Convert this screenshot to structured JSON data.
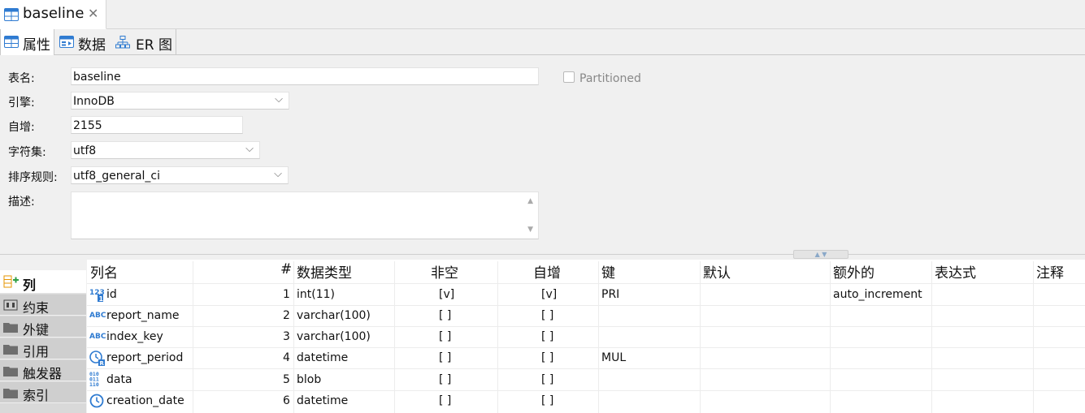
{
  "editor_tab": {
    "title": "baseline",
    "close": "✕"
  },
  "subtabs": [
    {
      "label": "属性"
    },
    {
      "label": "数据"
    },
    {
      "label": "ER 图"
    }
  ],
  "form": {
    "table_name": {
      "label": "表名:",
      "value": "baseline"
    },
    "engine": {
      "label": "引擎:",
      "value": "InnoDB"
    },
    "auto_increment": {
      "label": "自增:",
      "value": "2155"
    },
    "charset": {
      "label": "字符集:",
      "value": "utf8"
    },
    "collation": {
      "label": "排序规则:",
      "value": "utf8_general_ci"
    },
    "description": {
      "label": "描述:",
      "value": ""
    },
    "partitioned": {
      "label": "Partitioned",
      "checked": false
    }
  },
  "side_panel": {
    "items": [
      {
        "label": "列",
        "icon": "add-column-icon",
        "active": true
      },
      {
        "label": "约束",
        "icon": "constraint-icon",
        "active": false
      },
      {
        "label": "外键",
        "icon": "folder-icon",
        "active": false
      },
      {
        "label": "引用",
        "icon": "folder-icon",
        "active": false
      },
      {
        "label": "触发器",
        "icon": "folder-icon",
        "active": false
      },
      {
        "label": "索引",
        "icon": "folder-icon",
        "active": false
      }
    ]
  },
  "columns_table": {
    "headers": {
      "name": "列名",
      "num": "#",
      "type": "数据类型",
      "not_null": "非空",
      "auto_inc": "自增",
      "key": "键",
      "default": "默认",
      "extra": "额外的",
      "expression": "表达式",
      "comment": "注释"
    },
    "rows": [
      {
        "icon": "numeric-key-icon",
        "name": "id",
        "num": "1",
        "type": "int(11)",
        "not_null": "[v]",
        "auto_inc": "[v]",
        "key": "PRI",
        "default": "",
        "extra": "auto_increment",
        "expression": "",
        "comment": ""
      },
      {
        "icon": "text-abc-icon",
        "name": "report_name",
        "num": "2",
        "type": "varchar(100)",
        "not_null": "[ ]",
        "auto_inc": "[ ]",
        "key": "",
        "default": "",
        "extra": "",
        "expression": "",
        "comment": ""
      },
      {
        "icon": "text-abc-icon",
        "name": "index_key",
        "num": "3",
        "type": "varchar(100)",
        "not_null": "[ ]",
        "auto_inc": "[ ]",
        "key": "",
        "default": "",
        "extra": "",
        "expression": "",
        "comment": ""
      },
      {
        "icon": "clock-key-icon",
        "name": "report_period",
        "num": "4",
        "type": "datetime",
        "not_null": "[ ]",
        "auto_inc": "[ ]",
        "key": "MUL",
        "default": "",
        "extra": "",
        "expression": "",
        "comment": ""
      },
      {
        "icon": "binary-icon",
        "name": "data",
        "num": "5",
        "type": "blob",
        "not_null": "[ ]",
        "auto_inc": "[ ]",
        "key": "",
        "default": "",
        "extra": "",
        "expression": "",
        "comment": ""
      },
      {
        "icon": "clock-icon",
        "name": "creation_date",
        "num": "6",
        "type": "datetime",
        "not_null": "[ ]",
        "auto_inc": "[ ]",
        "key": "",
        "default": "",
        "extra": "",
        "expression": "",
        "comment": ""
      }
    ]
  },
  "colors": {
    "accent_blue": "#2f7bd1",
    "icon_orange": "#e69500",
    "selected_tab_bg": "#ffffff"
  }
}
